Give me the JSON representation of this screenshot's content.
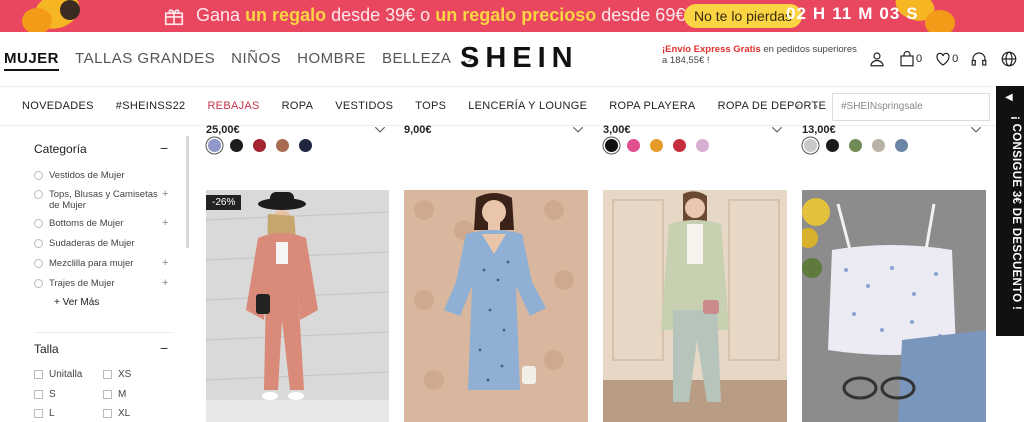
{
  "promo": {
    "text_1": "Gana",
    "gift_1": "un regalo",
    "text_2": "desde 39€ o",
    "gift_2": "un regalo precioso",
    "text_3": "desde 69€",
    "pill": "No te lo pierdas",
    "countdown": [
      "02",
      "H",
      "11",
      "M",
      "03",
      "S"
    ]
  },
  "header": {
    "categories": [
      "MUJER",
      "TALLAS GRANDES",
      "NIÑOS",
      "HOMBRE",
      "BELLEZA"
    ],
    "more_arrow": "›",
    "logo": "SHEIN",
    "express_bold": "¡Envío Express Gratis",
    "express_rest": "en pedidos superiores a 184,55€ !",
    "cart_count": "0",
    "wishlist_count": "0"
  },
  "subnav": {
    "items": [
      "NOVEDADES",
      "#SHEINSS22",
      "REBAJAS",
      "ROPA",
      "VESTIDOS",
      "TOPS",
      "LENCERÍA Y LOUNGE",
      "ROPA PLAYERA",
      "ROPA DE DEPORTE"
    ],
    "search_placeholder": "#SHEINspringsale"
  },
  "side_tab": {
    "arrow": "◀",
    "text": "¡ CONSIGUE 3€ DE DESCUENTO !"
  },
  "filters": {
    "categoria_title": "Categoría",
    "categories": [
      {
        "label": "Vestidos de Mujer",
        "expandable": false
      },
      {
        "label": "Tops, Blusas y Camisetas de Mujer",
        "expandable": true
      },
      {
        "label": "Bottoms de Mujer",
        "expandable": true
      },
      {
        "label": "Sudaderas de Mujer",
        "expandable": false
      },
      {
        "label": "Mezclilla para mujer",
        "expandable": true
      },
      {
        "label": "Trajes de Mujer",
        "expandable": true
      }
    ],
    "ver_mas": "+ Ver Más",
    "talla_title": "Talla",
    "sizes": [
      "Unitalla",
      "XS",
      "S",
      "M",
      "L",
      "XL"
    ]
  },
  "products": [
    {
      "price": "25,00€",
      "swatches": [
        "#8f98c9",
        "#1c1c1c",
        "#a42431",
        "#a86a52",
        "#1f2640"
      ],
      "badge": "-26%",
      "image": "pink-suit-hat-photo"
    },
    {
      "price": "9,00€",
      "swatches": [],
      "badge": "",
      "image": "blue-polka-dress-photo"
    },
    {
      "price": "3,00€",
      "swatches": [
        "#111111",
        "#e24f8f",
        "#e59a2a",
        "#c62e3f",
        "#d9aed3"
      ],
      "badge": "",
      "image": "floral-coat-outfit-photo"
    },
    {
      "price": "13,00€",
      "swatches": [
        "#c9c9c9",
        "#1b1b1b",
        "#6f8a54",
        "#b9b2a6",
        "#6a86a4"
      ],
      "badge": "",
      "image": "floral-cami-top-photo"
    }
  ],
  "colors": {
    "promo_bg": "#e8475f",
    "promo_accent": "#fbd443",
    "sale": "#c6324a",
    "express": "#e2322c"
  }
}
